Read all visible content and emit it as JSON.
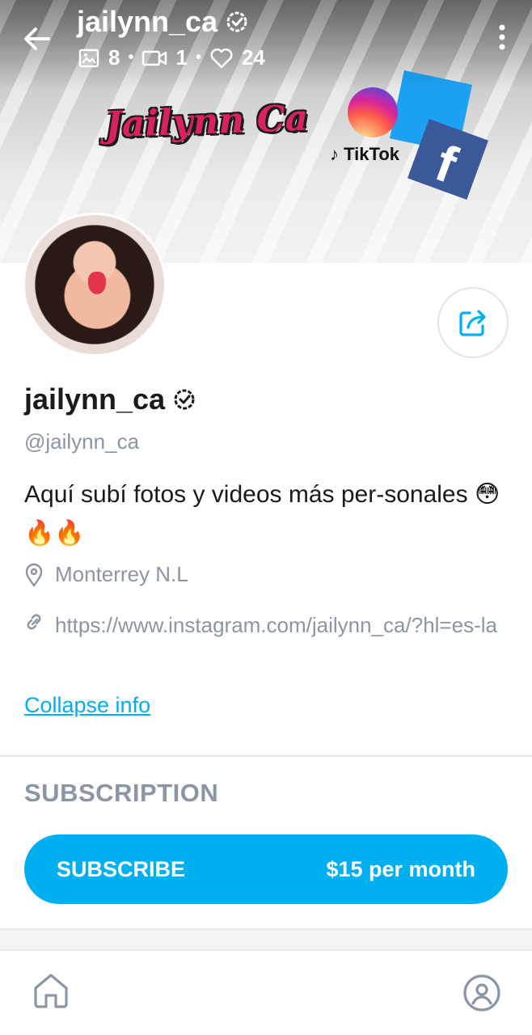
{
  "header": {
    "title": "jailynn_ca",
    "stats": {
      "photos": "8",
      "videos": "1",
      "likes": "24"
    }
  },
  "banner": {
    "logo_text": "Jailynn Ca",
    "tiktok_label": "TikTok",
    "facebook_letter": "f"
  },
  "profile": {
    "name": "jailynn_ca",
    "handle": "@jailynn_ca",
    "bio": "Aquí subí fotos y videos más per-sonales 😳🔥🔥",
    "location": "Monterrey N.L",
    "link": "https://www.instagram.com/jailynn_ca/?hl=es-la",
    "collapse_label": "Collapse info"
  },
  "subscription": {
    "section_title": "SUBSCRIPTION",
    "button_label": "SUBSCRIBE",
    "price": "$15 per month"
  },
  "colors": {
    "accent": "#00aff0",
    "muted": "#8a96a3",
    "text": "#1a1a1a"
  },
  "icons": {
    "back": "arrow-left-icon",
    "verified": "verified-badge-icon",
    "photo": "image-icon",
    "video": "video-camera-icon",
    "like": "heart-icon",
    "menu": "more-vertical-icon",
    "share": "share-icon",
    "location": "location-pin-icon",
    "link": "link-icon",
    "home": "home-icon",
    "profile": "user-circle-icon"
  }
}
